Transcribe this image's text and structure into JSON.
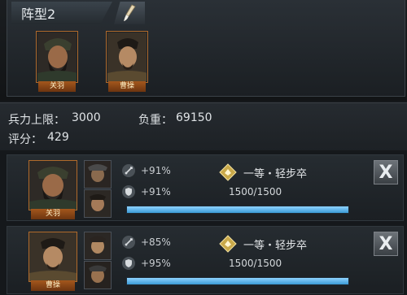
{
  "formation": {
    "title": "阵型2"
  },
  "heroes": [
    {
      "name": "关羽"
    },
    {
      "name": "曹操"
    }
  ],
  "stats": {
    "troop_cap_label": "兵力上限：",
    "troop_cap_value": "3000",
    "load_label": "负重：",
    "load_value": "69150",
    "score_label": "评分：",
    "score_value": "429"
  },
  "rows": [
    {
      "hero_name": "关羽",
      "attack_bonus": "+91%",
      "defense_bonus": "+91%",
      "unit_type": "一等・轻步卒",
      "troops": "1500/1500",
      "troop_fraction": 1.0
    },
    {
      "hero_name": "曹操",
      "attack_bonus": "+85%",
      "defense_bonus": "+95%",
      "unit_type": "一等・轻步卒",
      "troops": "1500/1500",
      "troop_fraction": 1.0
    }
  ],
  "close_label": "X",
  "colors": {
    "accent": "#b06a2b",
    "bar": "#3a9ad6"
  }
}
